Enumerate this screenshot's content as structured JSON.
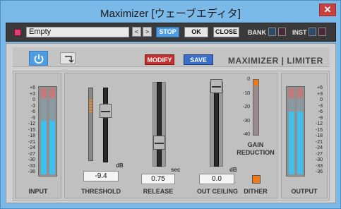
{
  "window": {
    "title": "Maximizer [ウェーブエディタ]",
    "close": "✕"
  },
  "toolbar": {
    "preset": "Empty",
    "prev": "<",
    "next": ">",
    "stop": "STOP",
    "ok": "OK",
    "close": "CLOSE",
    "bank": "BANK",
    "inst": "INST"
  },
  "header": {
    "modify": "MODIFY",
    "save": "SAVE",
    "brand": "MAXIMIZER | LIMITER"
  },
  "meters": {
    "scale": [
      "+6",
      "+3",
      "0",
      "-3",
      "-6",
      "-9",
      "-12",
      "-15",
      "-18",
      "-21",
      "-24",
      "-27",
      "-30",
      "-33",
      "-36"
    ],
    "input_label": "INPUT",
    "output_label": "OUTPUT",
    "input_level_frac": 0.62,
    "output_level_frac": 0.73
  },
  "threshold": {
    "label": "THRESHOLD",
    "unit": "dB",
    "value": "-9.4"
  },
  "release": {
    "label": "RELEASE",
    "unit": "sec",
    "value": "0.75"
  },
  "out_ceiling": {
    "label": "OUT CEILING",
    "unit": "dB",
    "value": "0.0"
  },
  "gain_reduction": {
    "label_1": "GAIN",
    "label_2": "REDUCTION",
    "scale": [
      "0",
      "-10",
      "-20",
      "-30",
      "-40"
    ]
  },
  "dither": {
    "label": "DITHER",
    "on": true
  },
  "colors": {
    "accent_blue": "#4e9de0",
    "meter_cyan": "#40c0ee",
    "modify_red": "#c43030",
    "save_blue": "#3a6ec8",
    "orange": "#f07a1a"
  }
}
